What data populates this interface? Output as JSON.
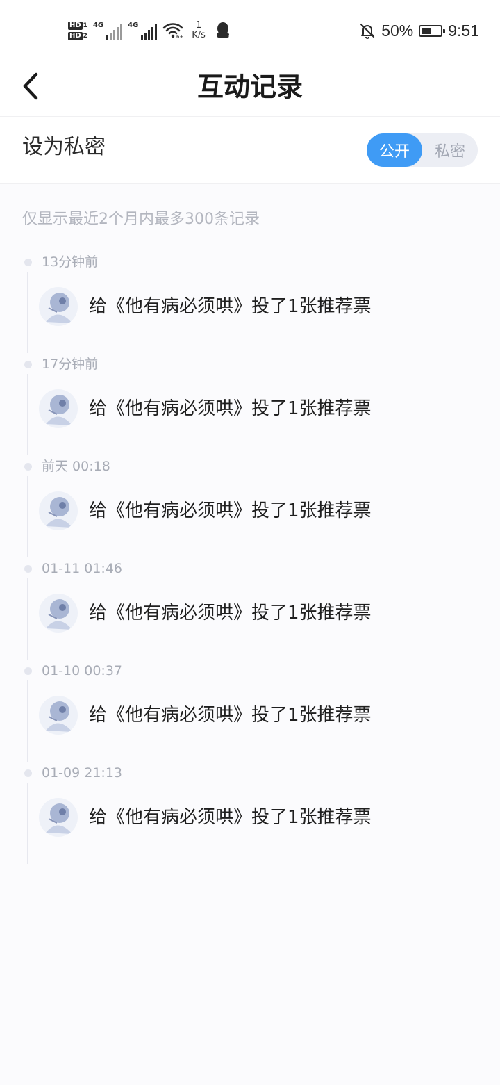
{
  "status_bar": {
    "hd1": "HD",
    "hd1_num": "1",
    "hd2": "HD",
    "hd2_num": "2",
    "sim1_type": "4G",
    "sim2_type": "4G",
    "net_speed_value": "1",
    "net_speed_unit": "K/s",
    "battery_percent": "50%",
    "battery_level": 0.5,
    "time": "9:51"
  },
  "header": {
    "title": "互动记录"
  },
  "privacy": {
    "label": "设为私密",
    "options": [
      "公开",
      "私密"
    ],
    "selected": "公开",
    "accent_color": "#3f9bf5"
  },
  "hint": "仅显示最近2个月内最多300条记录",
  "records": [
    {
      "time": "13分钟前",
      "text": "给《他有病必须哄》投了1张推荐票"
    },
    {
      "time": "17分钟前",
      "text": "给《他有病必须哄》投了1张推荐票"
    },
    {
      "time": "前天 00:18",
      "text": "给《他有病必须哄》投了1张推荐票"
    },
    {
      "time": "01-11 01:46",
      "text": "给《他有病必须哄》投了1张推荐票"
    },
    {
      "time": "01-10 00:37",
      "text": "给《他有病必须哄》投了1张推荐票"
    },
    {
      "time": "01-09 21:13",
      "text": "给《他有病必须哄》投了1张推荐票"
    }
  ]
}
